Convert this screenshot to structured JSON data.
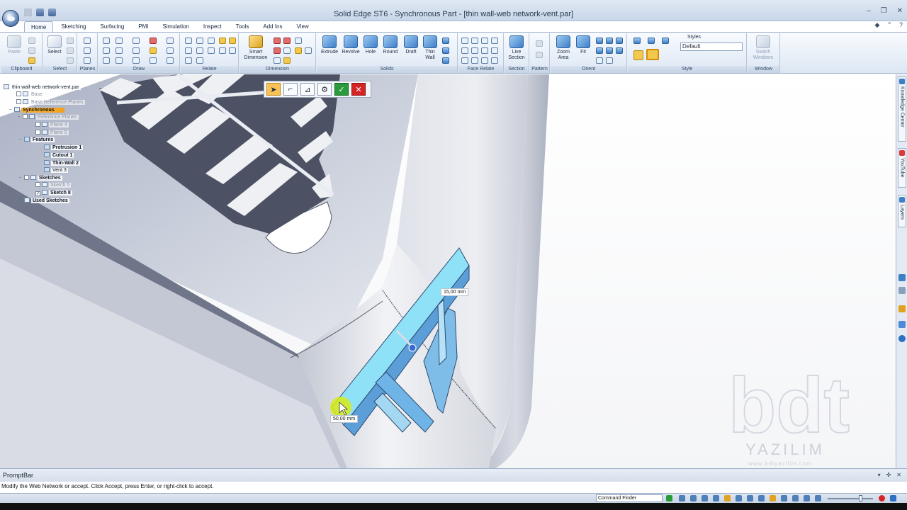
{
  "window": {
    "title": "Solid Edge ST6 - Synchronous Part - [thin wall-web network-vent.par]",
    "controls": [
      "–",
      "❐",
      "✕"
    ]
  },
  "ribbon": {
    "tabs": [
      "Home",
      "Sketching",
      "Surfacing",
      "PMI",
      "Simulation",
      "Inspect",
      "Tools",
      "Add Ins",
      "View"
    ],
    "active_tab": "Home",
    "groups": {
      "clipboard": "Clipboard",
      "select": "Select",
      "planes": "Planes",
      "draw": "Draw",
      "relate": "Relate",
      "dimension": "Dimension",
      "solids": "Solids",
      "face_relate": "Face Relate",
      "section": "Section",
      "pattern": "Pattern",
      "orient": "Orient",
      "style": "Style",
      "window": "Window"
    },
    "buttons": {
      "paste": "Paste",
      "select": "Select",
      "smart_dimension": [
        "Smart",
        "Dimension"
      ],
      "extrude": "Extrude",
      "revolve": "Revolve",
      "hole": "Hole",
      "round": "Round",
      "draft": "Draft",
      "thin_wall": [
        "Thin",
        "Wall"
      ],
      "live_section": [
        "Live",
        "Section"
      ],
      "zoom_area": [
        "Zoom",
        "Area"
      ],
      "fit": "Fit",
      "switch_windows": [
        "Switch",
        "Windows"
      ]
    },
    "styles_caption": "Styles",
    "styles_value": "Default"
  },
  "command_bar": {
    "accept_icon": "✓",
    "cancel_icon": "✕"
  },
  "pathfinder": {
    "root": "thin wall-web network-vent.par",
    "base": "Base",
    "base_reference_planes": "Base Reference Planes",
    "synchronous": "Synchronous",
    "reference_planes": "Reference Planes",
    "plane4": "Plane 4",
    "plane5": "Plane 5",
    "features": "Features",
    "protrusion1": "Protrusion 1",
    "cutout1": "Cutout 1",
    "thinwall2": "Thin-Wall 2",
    "vent3": "Vent 3",
    "sketches": "Sketches",
    "sketch5": "Sketch 5",
    "sketch8": "Sketch 8",
    "used_sketches": "Used Sketches"
  },
  "dimensions": {
    "thickness": "15,00 mm",
    "length": "50,00 mm"
  },
  "watermark": {
    "logo": "bdt",
    "name": "YAZILIM",
    "url": "www.bdtyazilim.com"
  },
  "dock": {
    "knowledge_center": "Knowledge Center",
    "youtube": "YouTube",
    "layers": "Layers"
  },
  "promptbar": {
    "title": "PromptBar",
    "message": "Modify the Web Network or accept.  Click Accept, press Enter, or right-click to accept."
  },
  "statusbar": {
    "command_finder": "Command Finder"
  },
  "colors": {
    "highlight": "#f2a21f",
    "selection": "#8fe1f7",
    "accept": "#2a9b3a",
    "cancel": "#d62323"
  }
}
